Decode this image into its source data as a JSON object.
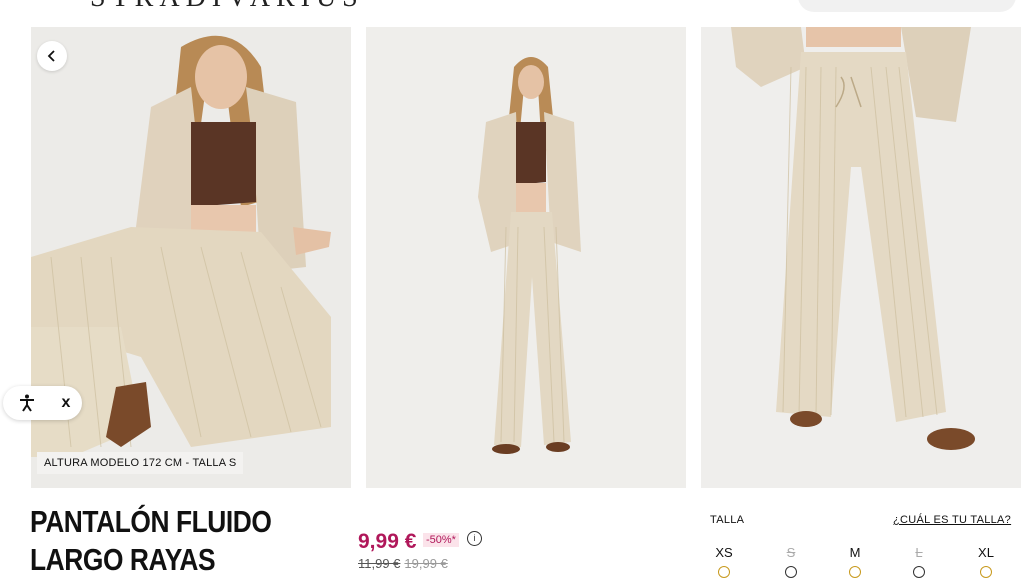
{
  "header": {
    "logo_text": "STRADIVARIUS"
  },
  "gallery": {
    "back_label": "‹",
    "model_info": "ALTURA MODELO 172 CM - TALLA S"
  },
  "accessibility": {
    "close_label": "x"
  },
  "product": {
    "title_line1": "PANTALÓN FLUIDO",
    "title_line2": "LARGO RAYAS",
    "price": "9,99 €",
    "discount": "-50%*",
    "info_label": "i",
    "old_price": "11,99 €",
    "original_price": "19,99 €",
    "price_color": "#b0175a"
  },
  "sizes": {
    "label": "TALLA",
    "guide_link": "¿CUÁL ES TU TALLA?",
    "options": [
      {
        "label": "XS",
        "available": true,
        "indicator": "clock-icon"
      },
      {
        "label": "S",
        "available": false,
        "indicator": "bell-icon"
      },
      {
        "label": "M",
        "available": true,
        "indicator": "clock-icon"
      },
      {
        "label": "L",
        "available": false,
        "indicator": "bell-icon"
      },
      {
        "label": "XL",
        "available": true,
        "indicator": "clock-icon"
      }
    ]
  }
}
